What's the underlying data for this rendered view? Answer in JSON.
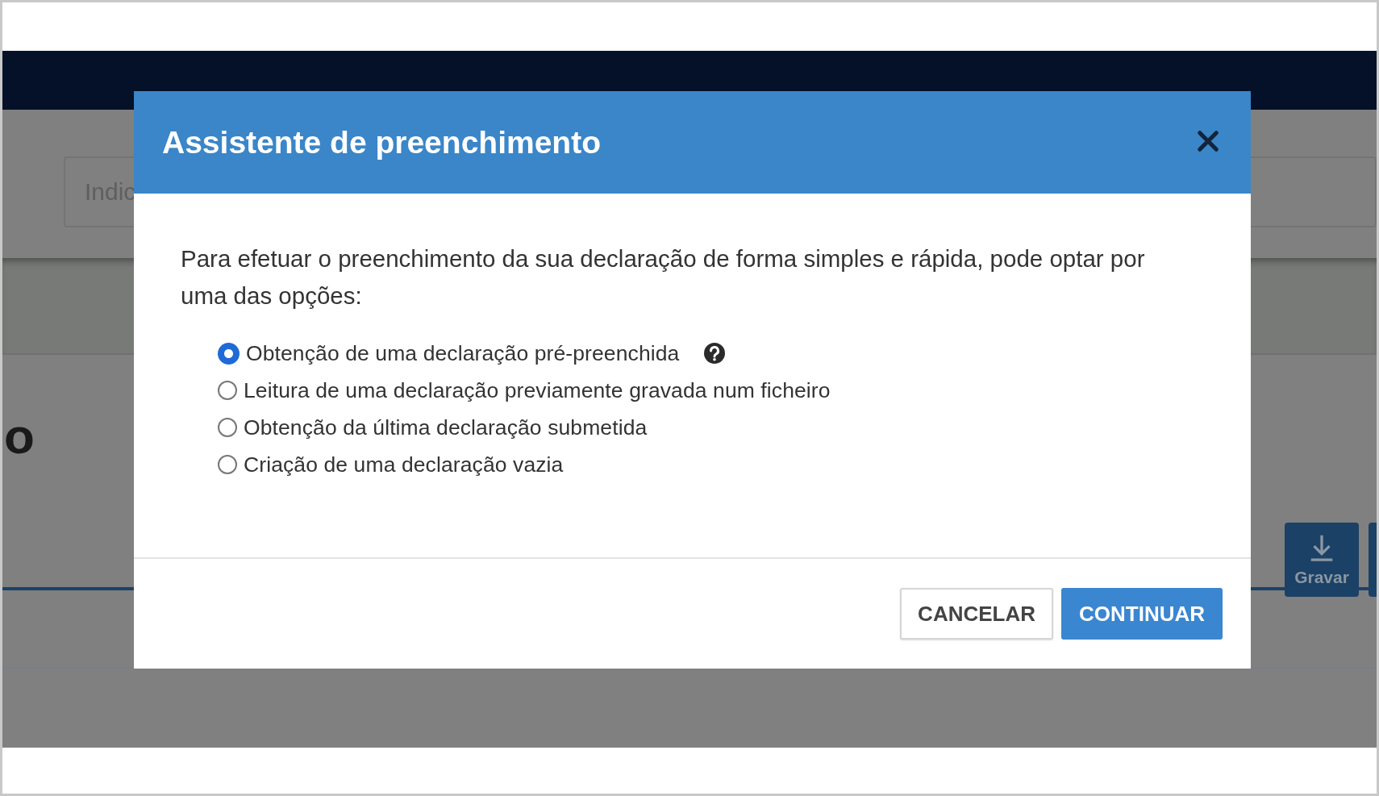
{
  "background": {
    "field": {
      "text": "Indic"
    },
    "heading_fragment": "o",
    "toolbar_buttons": [
      {
        "label": "Gravar"
      }
    ]
  },
  "dialog": {
    "title": "Assistente de preenchimento",
    "intro": "Para efetuar o preenchimento da sua declaração de forma simples e rápida, pode optar por uma das opções:",
    "options": [
      {
        "label": "Obtenção de uma declaração pré-preenchida",
        "selected": true,
        "help": true
      },
      {
        "label": "Leitura de uma declaração previamente gravada num ficheiro",
        "selected": false,
        "help": false
      },
      {
        "label": "Obtenção da última declaração submetida",
        "selected": false,
        "help": false
      },
      {
        "label": "Criação de uma declaração vazia",
        "selected": false,
        "help": false
      }
    ],
    "buttons": [
      {
        "label": "CANCELAR",
        "kind": "secondary"
      },
      {
        "label": "CONTINUAR",
        "kind": "primary"
      }
    ]
  }
}
